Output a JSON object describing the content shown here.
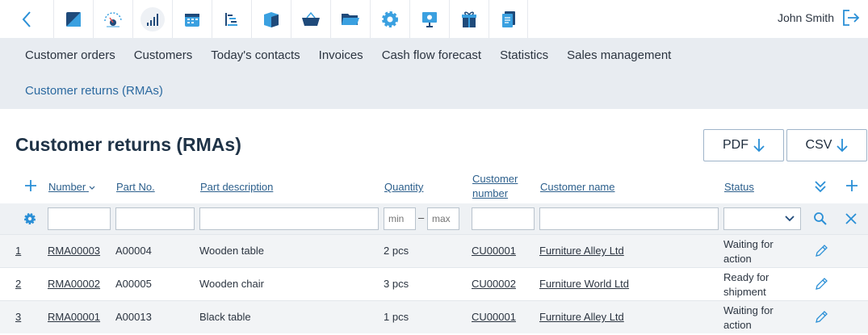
{
  "user": {
    "name": "John Smith"
  },
  "nav": {
    "row1": [
      "Customer orders",
      "Customers",
      "Today's contacts",
      "Invoices",
      "Cash flow forecast",
      "Statistics",
      "Sales management"
    ],
    "row2": [
      "Customer returns (RMAs)"
    ]
  },
  "page": {
    "title": "Customer returns (RMAs)",
    "pdf_label": "PDF",
    "csv_label": "CSV"
  },
  "table": {
    "columns": {
      "number": "Number",
      "part_no": "Part No.",
      "part_description": "Part description",
      "quantity": "Quantity",
      "customer_number_line1": "Customer",
      "customer_number_line2": "number",
      "customer_name": "Customer name",
      "status": "Status"
    },
    "filters": {
      "qty_min_placeholder": "min",
      "qty_max_placeholder": "max",
      "range_separator": "–"
    },
    "rows": [
      {
        "index": "1",
        "number": "RMA00003",
        "part_no": "A00004",
        "description": "Wooden table",
        "quantity": "2 pcs",
        "customer_number": "CU00001",
        "customer_name": "Furniture Alley Ltd",
        "status": "Waiting for action"
      },
      {
        "index": "2",
        "number": "RMA00002",
        "part_no": "A00005",
        "description": "Wooden chair",
        "quantity": "3 pcs",
        "customer_number": "CU00002",
        "customer_name": "Furniture World Ltd",
        "status": "Ready for shipment"
      },
      {
        "index": "3",
        "number": "RMA00001",
        "part_no": "A00013",
        "description": "Black table",
        "quantity": "1 pcs",
        "customer_number": "CU00001",
        "customer_name": "Furniture Alley Ltd",
        "status": "Waiting for action"
      }
    ]
  },
  "icons": {
    "apps": [
      "dashboard-icon",
      "speedometer-icon",
      "signal-bars-icon",
      "calendar-icon",
      "gantt-icon",
      "box-icon",
      "basket-icon",
      "folder-icon",
      "gear-icon",
      "presentation-icon",
      "gift-icon",
      "document-icon"
    ]
  },
  "colors": {
    "accent": "#2a8fd6",
    "nav_bg": "#e8ecf1",
    "title": "#1f3347"
  }
}
